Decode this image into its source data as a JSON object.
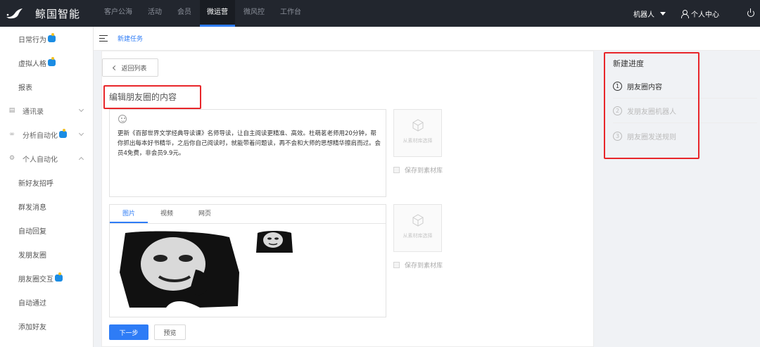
{
  "topbar": {
    "brand": "鲸国智能",
    "nav": [
      {
        "label": "客户公海",
        "active": false
      },
      {
        "label": "活动",
        "active": false
      },
      {
        "label": "会员",
        "active": false
      },
      {
        "label": "微运营",
        "active": true
      },
      {
        "label": "微风控",
        "active": false
      },
      {
        "label": "工作台",
        "active": false
      }
    ],
    "robot_menu": "机器人",
    "user_center": "个人中心"
  },
  "sidebar": {
    "items": [
      {
        "label": "日常行为",
        "type": "sub",
        "badge": true
      },
      {
        "label": "虚拟人格",
        "type": "sub",
        "badge": true
      },
      {
        "label": "报表",
        "type": "sub",
        "badge": false
      },
      {
        "label": "通讯录",
        "type": "group",
        "icon": "contacts-icon",
        "expanded": false
      },
      {
        "label": "分析自动化",
        "type": "group",
        "icon": "analytics-icon",
        "badge": true,
        "expanded": false
      },
      {
        "label": "个人自动化",
        "type": "group",
        "icon": "settings-icon",
        "expanded": true
      },
      {
        "label": "新好友招呼",
        "type": "sub",
        "badge": false
      },
      {
        "label": "群发消息",
        "type": "sub",
        "badge": false
      },
      {
        "label": "自动回复",
        "type": "sub",
        "badge": false
      },
      {
        "label": "发朋友圈",
        "type": "sub",
        "badge": false
      },
      {
        "label": "朋友圈交互",
        "type": "sub",
        "badge": true
      },
      {
        "label": "自动通过",
        "type": "sub",
        "badge": false
      },
      {
        "label": "添加好友",
        "type": "sub",
        "badge": false
      }
    ]
  },
  "breadcrumb": {
    "current": "新建任务"
  },
  "main": {
    "back_label": "返回列表",
    "section_title": "编辑朋友圈的内容",
    "editor_text": "更新《百部世界文学经典导读课》名师导读，让自主阅读更精准、高效。杜萌茗老师用20分钟，帮你抓出每本好书精华，之后你自己阅读时，就能带着问题读，再不会和大师的思想精华擦肩而过。会员4免费，非会员9.9元。",
    "library_label": "从素材库选择",
    "save_label": "保存到素材库",
    "tabs": [
      {
        "label": "图片",
        "active": true
      },
      {
        "label": "视频",
        "active": false
      },
      {
        "label": "网页",
        "active": false
      }
    ],
    "next_label": "下一步",
    "preview_label": "预览"
  },
  "progress": {
    "title": "新建进度",
    "steps": [
      {
        "num": "1",
        "label": "朋友圈内容",
        "active": true
      },
      {
        "num": "2",
        "label": "发朋友圈机器人",
        "active": false
      },
      {
        "num": "3",
        "label": "朋友圈发送规则",
        "active": false
      }
    ]
  },
  "colors": {
    "accent": "#2e7cf6",
    "topbar": "#22262e",
    "highlight": "#e8262a"
  }
}
